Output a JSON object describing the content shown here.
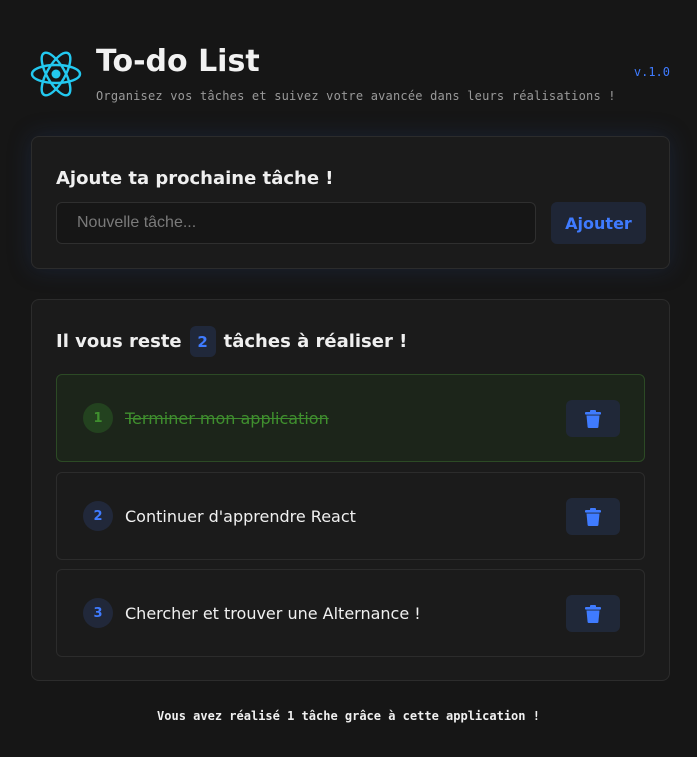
{
  "header": {
    "logo_icon": "react-atom-icon",
    "title": "To-do List",
    "subtitle": "Organisez vos tâches et suivez votre avancée dans leurs réalisations !",
    "version": "v.1.0"
  },
  "add_card": {
    "title": "Ajoute ta prochaine tâche !",
    "input_value": "",
    "input_placeholder": "Nouvelle tâche...",
    "add_button_label": "Ajouter"
  },
  "list_card": {
    "remaining_prefix": "Il vous reste",
    "remaining_count": "2",
    "remaining_suffix": "tâches à réaliser !",
    "tasks": [
      {
        "number": "1",
        "text": "Terminer mon application",
        "done": true,
        "delete_icon": "trash-icon"
      },
      {
        "number": "2",
        "text": "Continuer d'apprendre React",
        "done": false,
        "delete_icon": "trash-icon"
      },
      {
        "number": "3",
        "text": "Chercher et trouver une Alternance !",
        "done": false,
        "delete_icon": "trash-icon"
      }
    ]
  },
  "footer": {
    "text": "Vous avez réalisé 1 tâche grâce à cette application !"
  },
  "colors": {
    "background": "#161616",
    "card": "#1b1b1b",
    "accent_blue": "#3f7bff",
    "done_green": "#3f8f2e",
    "react_cyan": "#23c9f0"
  }
}
